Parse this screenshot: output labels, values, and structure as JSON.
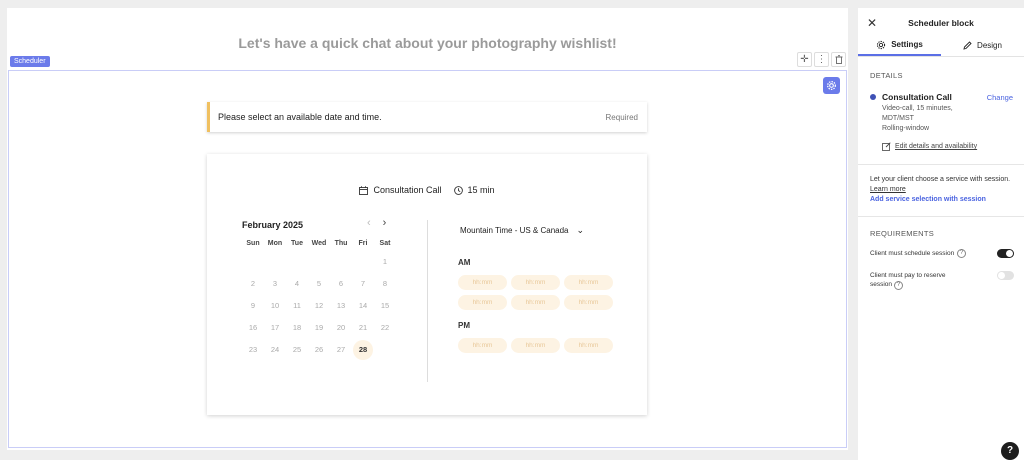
{
  "canvas": {
    "headline": "Let's have a quick chat about your photography wishlist!",
    "block_tag": "Scheduler"
  },
  "notice": {
    "text": "Please select an available date and time.",
    "required": "Required"
  },
  "card": {
    "service_name": "Consultation Call",
    "duration": "15 min",
    "calendar": {
      "month": "February 2025",
      "weekdays": [
        "Sun",
        "Mon",
        "Tue",
        "Wed",
        "Thu",
        "Fri",
        "Sat"
      ],
      "days": [
        "",
        "",
        "",
        "",
        "",
        "",
        "1",
        "2",
        "3",
        "4",
        "5",
        "6",
        "7",
        "8",
        "9",
        "10",
        "11",
        "12",
        "13",
        "14",
        "15",
        "16",
        "17",
        "18",
        "19",
        "20",
        "21",
        "22",
        "23",
        "24",
        "25",
        "26",
        "27",
        "28",
        ""
      ],
      "selected_day": "28"
    },
    "timezone": "Mountain Time - US & Canada",
    "am_label": "AM",
    "pm_label": "PM",
    "am_slots": [
      "hh:mm",
      "hh:mm",
      "hh:mm",
      "hh:mm",
      "hh:mm",
      "hh:mm"
    ],
    "pm_slots": [
      "hh:mm",
      "hh:mm",
      "hh:mm"
    ]
  },
  "panel": {
    "title": "Scheduler block",
    "tabs": [
      {
        "label": "Settings",
        "icon": "gear-icon",
        "active": true
      },
      {
        "label": "Design",
        "icon": "pencil-icon",
        "active": false
      }
    ],
    "details_label": "DETAILS",
    "service": {
      "name": "Consultation Call",
      "change": "Change",
      "desc_line1": "Video-call, 15 minutes,",
      "desc_line2": "MDT/MST",
      "desc_line3": "Rolling-window",
      "edit_link": "Edit details and availability"
    },
    "choose_text": "Let your client choose a service with session.",
    "learn_more": "Learn more",
    "add_link": "Add service selection with session",
    "requirements_label": "REQUIREMENTS",
    "req1": {
      "label": "Client must schedule session",
      "on": true
    },
    "req2": {
      "label_line1": "Client must pay to reserve",
      "label_line2": "session",
      "on": false
    }
  },
  "help": "?",
  "colors": {
    "accent": "#6b7bea",
    "link": "#4a63e0",
    "slot_bg": "#fdf3e3",
    "notice_border": "#f0c060"
  }
}
